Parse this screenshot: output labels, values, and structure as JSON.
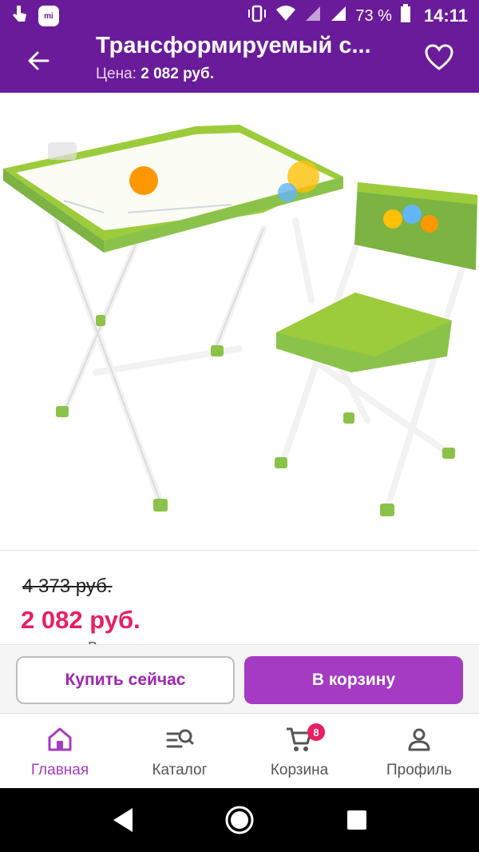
{
  "status_bar": {
    "time": "14:11",
    "battery_percent": "73 %",
    "mi_label": "mi",
    "icons": [
      "touch-icon",
      "mi-icon",
      "vibrate-icon",
      "wifi-icon",
      "signal-icon",
      "signal-icon",
      "battery-icon"
    ]
  },
  "app_bar": {
    "title": "Трансформируемый с...",
    "price_label": "Цена:",
    "price_value": "2 082 руб.",
    "icons": {
      "back": "arrow-left-icon",
      "favorite": "heart-outline-icon"
    }
  },
  "product": {
    "image_alt": "kids-folding-desk-and-chair",
    "old_price": "4 373 руб.",
    "new_price": "2 082 руб.",
    "peek_text": "В..."
  },
  "actions": {
    "buy_now": "Купить сейчас",
    "add_to_cart": "В корзину"
  },
  "bottom_nav": {
    "items": [
      {
        "label": "Главная",
        "icon": "home-icon",
        "active": true
      },
      {
        "label": "Каталог",
        "icon": "catalog-search-icon",
        "active": false
      },
      {
        "label": "Корзина",
        "icon": "cart-icon",
        "active": false,
        "badge": "8"
      },
      {
        "label": "Профиль",
        "icon": "person-icon",
        "active": false
      }
    ]
  },
  "system_nav": {
    "icons": [
      "back-triangle-icon",
      "home-circle-icon",
      "recents-square-icon"
    ]
  },
  "colors": {
    "brand": "#6a1b9a",
    "accent": "#a43bc2",
    "sale": "#e91e63"
  }
}
